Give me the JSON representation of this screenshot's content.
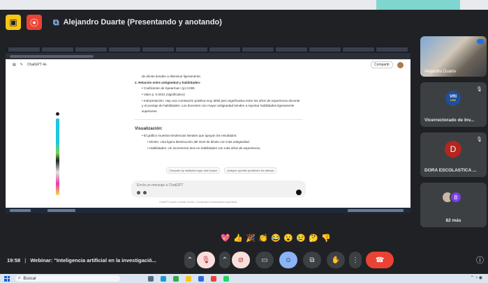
{
  "meet": {
    "presenter_label": "Alejandro Duarte (Presentando y anotando)",
    "time": "19:58",
    "separator": "|",
    "meeting_title": "Webinar: \"Inteligencia artificial en la investigació..."
  },
  "shared_screen": {
    "app_name": "ChatGPT 4o",
    "share_label": "Compartir",
    "doc": {
      "line0": "de dimito tienden a disminuir ligeramente.",
      "item2_heading": "2.  Relación entre antigüedad y habilidades:",
      "item2_bullet1": "•  Coeficiente de Spearman: (ρ) 0.065",
      "item2_bullet2": "•  Valor p: 0.0021 (significativo)",
      "item2_bullet3": "•  Interpretación: Hay una correlación positiva muy débil pero significativa entre los años de experiencia docente y el puntaje de habilidades. Los docentes con mayor antigüedad tienden a reportar habilidades ligeramente superiores.",
      "viz_heading": "Visualización:",
      "viz_bullet1": "•  El gráfico muestra tendencias lineales que apoyan los resultados:",
      "viz_sub1": "•  Dimito: Una ligera disminución del nivel de dimito con más antigüedad.",
      "viz_sub2": "•  Habilidades: Un incremento leve en habilidades con más años de experiencia."
    },
    "suggestions": [
      "Compare by institution type and impact",
      "Analyze specific predictors for distrust"
    ],
    "composer_placeholder": "Envía un mensaje a ChatGPT",
    "disclaimer": "ChatGPT puede cometer errores. Comprueba la información importante."
  },
  "participants": [
    {
      "name": "Alejandro Duarte",
      "type": "video"
    },
    {
      "name": "Vicerrectorado de Inv...",
      "logo_text": "VRI",
      "logo_sub": "UNE"
    },
    {
      "name": "DORA ESCOLASTICA ...",
      "initial": "D"
    },
    {
      "name": "82 más",
      "initial": "B"
    }
  ],
  "reactions": [
    "💖",
    "👍",
    "🎉",
    "👏",
    "😂",
    "😮",
    "😢",
    "🤔",
    "👎"
  ],
  "controls": [
    {
      "name": "mic",
      "icon": "mic-off-icon",
      "glyph": "🎙"
    },
    {
      "name": "camera",
      "icon": "camera-off-icon",
      "glyph": "⊘"
    },
    {
      "name": "captions",
      "icon": "captions-icon",
      "glyph": "▭"
    },
    {
      "name": "emoji",
      "icon": "emoji-icon",
      "glyph": "☺"
    },
    {
      "name": "present",
      "icon": "present-icon",
      "glyph": "⧉"
    },
    {
      "name": "raise-hand",
      "icon": "hand-icon",
      "glyph": "✋"
    },
    {
      "name": "more",
      "icon": "more-vert-icon",
      "glyph": "⋮"
    },
    {
      "name": "leave",
      "icon": "hang-up-icon",
      "glyph": "☎"
    }
  ],
  "info_glyph": "ⓘ",
  "taskbar": {
    "search_placeholder": "Buscar"
  },
  "colors": {
    "meet_bg": "#202124",
    "tile_bg": "#3c4043",
    "hangup": "#ea4335",
    "active_blue": "#8ab4f8"
  }
}
